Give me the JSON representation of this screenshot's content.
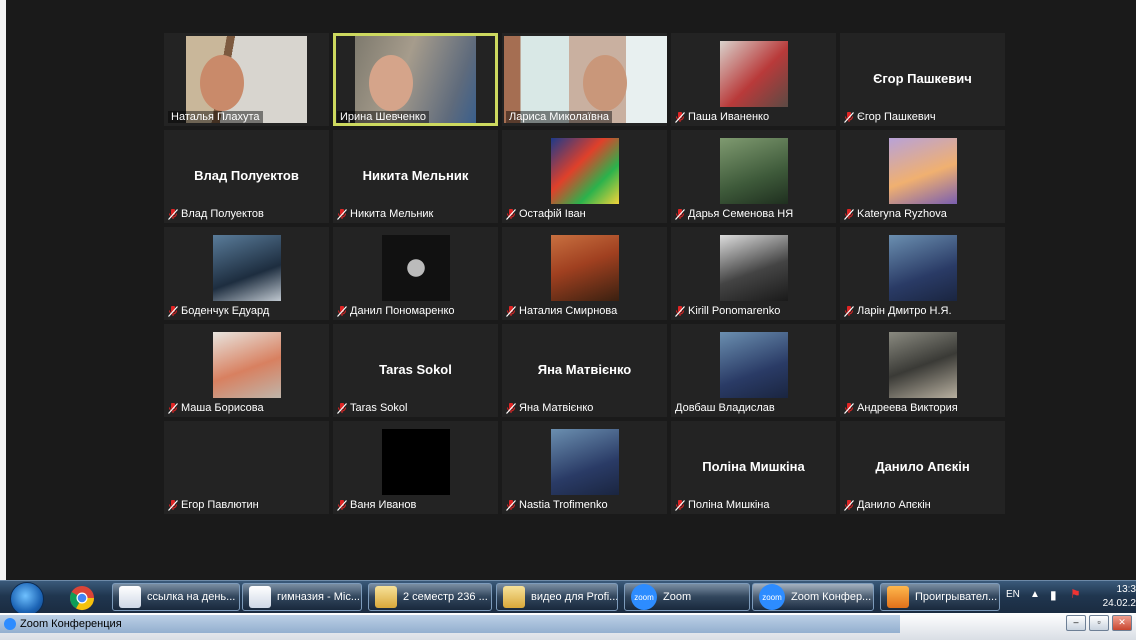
{
  "colors": {
    "background": "#1a1a1a",
    "tile": "#232323",
    "active_speaker_border": "#cdd95f",
    "mute_icon": "#e02424"
  },
  "participants": [
    {
      "name": "Наталья Плахута",
      "muted": false,
      "view": "video"
    },
    {
      "name": "Ирина Шевченко",
      "muted": false,
      "view": "video",
      "active": true
    },
    {
      "name": "Лариса Миколаївна",
      "muted": false,
      "view": "video"
    },
    {
      "name": "Паша Иваненко",
      "muted": true,
      "view": "picture"
    },
    {
      "name": "Єгор Пашкевич",
      "muted": true,
      "view": "name"
    },
    {
      "name": "Влад Полуектов",
      "muted": true,
      "view": "name"
    },
    {
      "name": "Никита Мельник",
      "muted": true,
      "view": "name"
    },
    {
      "name": "Остафій Іван",
      "muted": true,
      "view": "picture"
    },
    {
      "name": "Дарья Семенова НЯ",
      "muted": true,
      "view": "picture"
    },
    {
      "name": "Kateryna Ryzhova",
      "muted": true,
      "view": "picture"
    },
    {
      "name": "Боденчук Едуард",
      "muted": true,
      "view": "picture"
    },
    {
      "name": "Данил Пономаренко",
      "muted": true,
      "view": "picture"
    },
    {
      "name": "Наталия Смирнова",
      "muted": true,
      "view": "picture"
    },
    {
      "name": "Kirill Ponomarenko",
      "muted": true,
      "view": "picture"
    },
    {
      "name": "Ларін Дмитро Н.Я.",
      "muted": true,
      "view": "picture"
    },
    {
      "name": "Маша Борисова",
      "muted": true,
      "view": "picture"
    },
    {
      "name": "Taras Sokol",
      "muted": true,
      "view": "name"
    },
    {
      "name": "Яна Матвієнко",
      "muted": true,
      "view": "name"
    },
    {
      "name": "Довбаш Владислав",
      "muted": false,
      "view": "picture"
    },
    {
      "name": "Андреева Виктория",
      "muted": true,
      "view": "picture"
    },
    {
      "name": "Егор Павлютин",
      "muted": true,
      "view": "blank"
    },
    {
      "name": "Ваня Иванов",
      "muted": true,
      "view": "picture"
    },
    {
      "name": "Nastia Trofimenko",
      "muted": true,
      "view": "picture"
    },
    {
      "name": "Поліна Мишкіна",
      "muted": true,
      "view": "name"
    },
    {
      "name": "Данило Апєкін",
      "muted": true,
      "view": "name"
    }
  ],
  "taskbar": {
    "buttons": [
      {
        "label": "ссылка на день...",
        "icon": "word-doc-icon"
      },
      {
        "label": "гимназия - Mic...",
        "icon": "word-doc-icon"
      },
      {
        "label": "2 семестр 236 ...",
        "icon": "folder-icon"
      },
      {
        "label": "видео для Profi...",
        "icon": "folder-icon"
      },
      {
        "label": "Zoom",
        "icon": "zoom-icon"
      },
      {
        "label": "Zoom Конфер...",
        "icon": "zoom-icon"
      },
      {
        "label": "Проигрывател...",
        "icon": "media-player-icon"
      }
    ],
    "language": "EN",
    "time": "13:3",
    "date": "24.02.2"
  },
  "zoom_window_bar": {
    "title": "Zoom Конференция"
  }
}
